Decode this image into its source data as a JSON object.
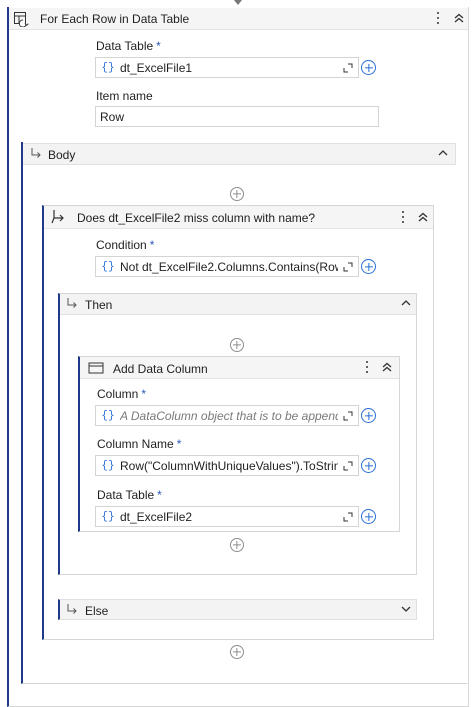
{
  "foreach": {
    "title": "For Each Row in Data Table",
    "data_table_label": "Data Table",
    "required_mark": "*",
    "data_table_value": "dt_ExcelFile1",
    "item_name_label": "Item name",
    "item_name_value": "Row",
    "body_label": "Body"
  },
  "if_activity": {
    "title": "Does dt_ExcelFile2 miss column with name?",
    "condition_label": "Condition",
    "condition_value": "Not dt_ExcelFile2.Columns.Contains(Row(\"",
    "then_label": "Then",
    "else_label": "Else"
  },
  "add_column": {
    "title": "Add Data Column",
    "column_label": "Column",
    "column_placeholder": "A DataColumn object that is to be appended",
    "column_name_label": "Column Name",
    "column_name_value": "Row(\"ColumnWithUniqueValues\").ToString",
    "data_table_label": "Data Table",
    "data_table_value": "dt_ExcelFile2"
  },
  "expression_brace": "{}",
  "colors": {
    "accent": "#2b55b8",
    "brace_blue": "#2b6fd6",
    "section_bg": "#f3f3f3"
  }
}
